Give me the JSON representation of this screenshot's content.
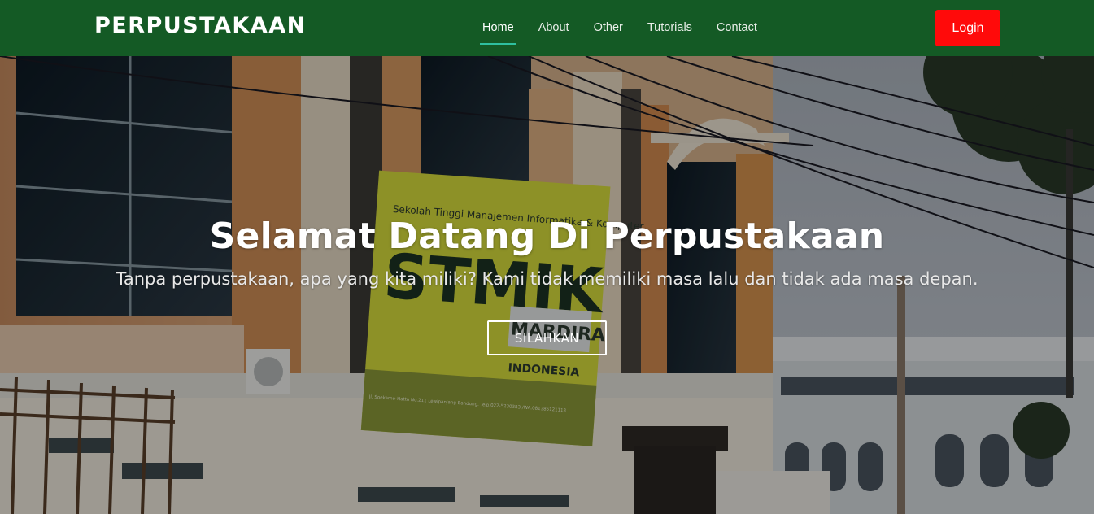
{
  "brand": "PERPUSTAKAAN",
  "nav": {
    "items": [
      {
        "label": "Home"
      },
      {
        "label": "About"
      },
      {
        "label": "Other"
      },
      {
        "label": "Tutorials"
      },
      {
        "label": "Contact"
      }
    ],
    "active_index": 0
  },
  "login_label": "Login",
  "hero": {
    "title": "Selamat Datang Di Perpustakaan",
    "subtitle": "Tanpa perpustakaan, apa yang kita miliki? Kami tidak memiliki masa lalu dan tidak ada masa depan.",
    "cta_label": "SILAHKAN",
    "sign": {
      "top_text": "Sekolah Tinggi Manajemen Informatika & Komputer",
      "main_text": "STMIK",
      "side_text": "MARDIRA",
      "side_text2": "INDONESIA",
      "address": "Jl. Soekarno-Hatta No.211 Lewipanjang Bandung. Telp.022-5230383 /WA.081385121113"
    }
  },
  "colors": {
    "navbar": "#145a25",
    "login": "#ff0a0a",
    "active_underline": "#2fc0a0"
  }
}
